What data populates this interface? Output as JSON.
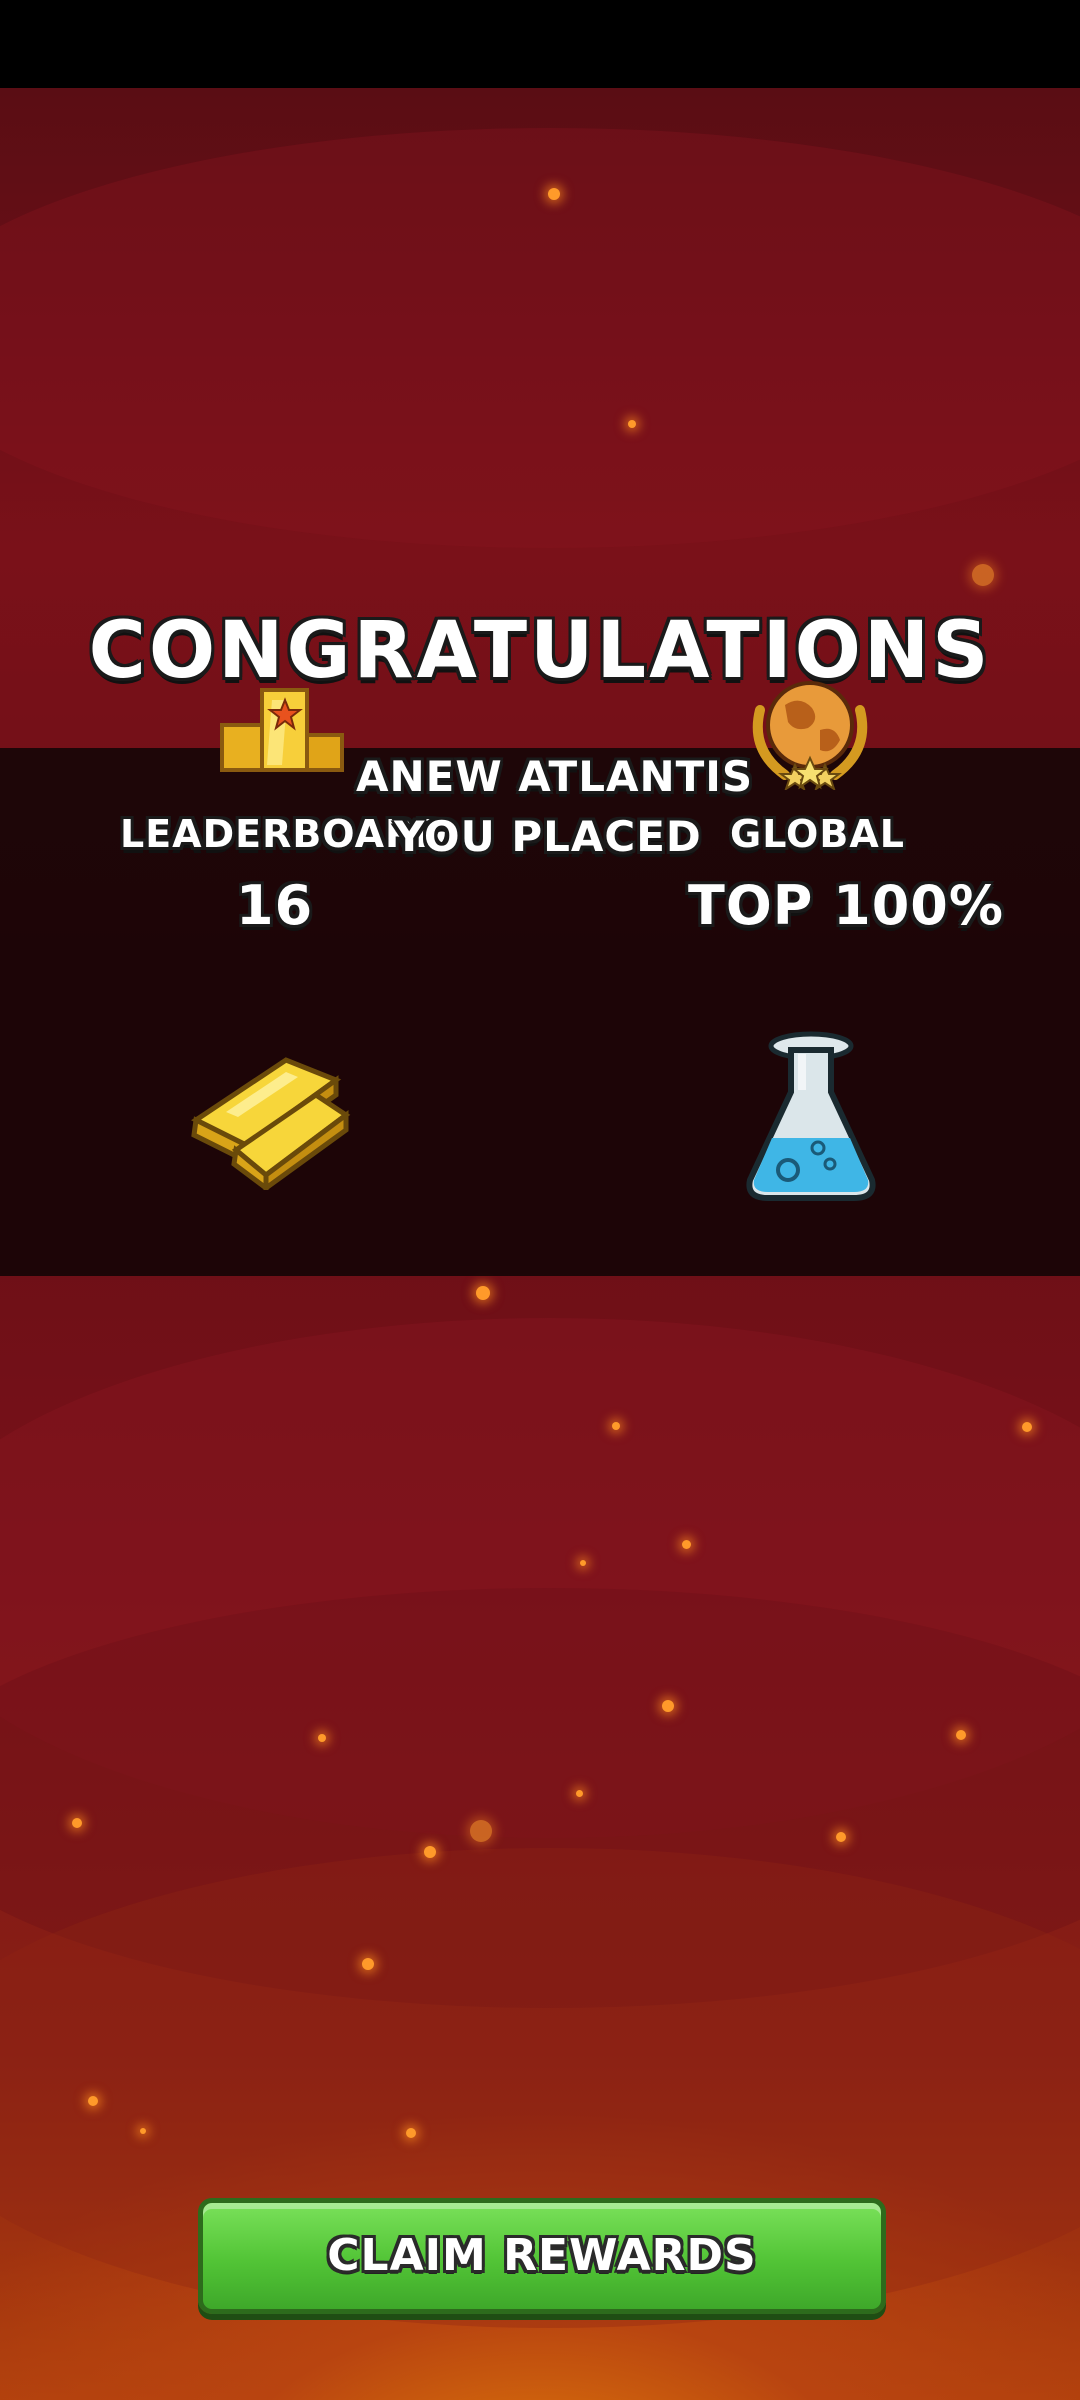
{
  "screen": {
    "title": "CONGRATULATIONS",
    "event_name": "ANEW ATLANTIS",
    "placement_label": "YOU PLACED"
  },
  "leaderboard": {
    "label": "LEADERBOARD",
    "value": "16",
    "icon": "podium-icon"
  },
  "global": {
    "label": "GLOBAL",
    "value": "TOP 100%",
    "icon": "globe-laurel-icon"
  },
  "rewards": [
    {
      "icon": "gold-bars-icon"
    },
    {
      "icon": "potion-flask-icon"
    }
  ],
  "claim_button": {
    "label": "CLAIM REWARDS"
  },
  "colors": {
    "button_green": "#52c436",
    "background_red": "#7a1119",
    "band_dark": "#120406",
    "accent_orange": "#e07a0a"
  }
}
